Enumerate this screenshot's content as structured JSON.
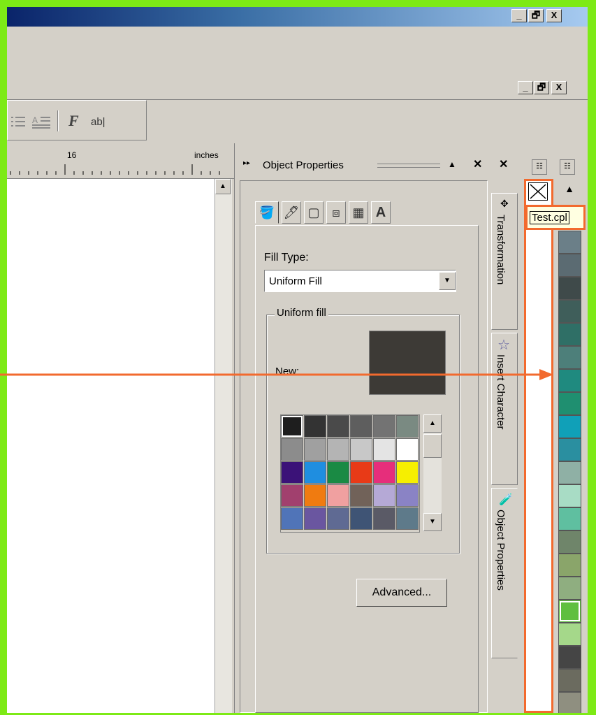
{
  "toolbar": {
    "format_f": "F",
    "text_ab": "ab|"
  },
  "ruler": {
    "tick_16": "16",
    "units": "inches"
  },
  "docker": {
    "title": "Object Properties",
    "fill_type_label": "Fill Type:",
    "fill_type_value": "Uniform Fill",
    "group_label": "Uniform fill",
    "new_label": "New:",
    "new_color": "#3d3a36",
    "advanced_button": "Advanced...",
    "tabs": [
      "fill-icon",
      "outline-icon",
      "general-icon",
      "detail-icon",
      "wrap-icon",
      "text-icon"
    ],
    "swatches": [
      "#1e1e1e",
      "#333333",
      "#4a4a4a",
      "#5e5e5e",
      "#737373",
      "#7a8a82",
      "#8c8c8c",
      "#a0a0a0",
      "#b4b4b4",
      "#c8c8c8",
      "#e4e4e4",
      "#ffffff",
      "#3b1278",
      "#1f8ee0",
      "#1a8a44",
      "#e83a17",
      "#e62e7b",
      "#f6ef00",
      "#a1406e",
      "#f07b10",
      "#f0a0a0",
      "#716259",
      "#b5a9d6",
      "#8a83c5",
      "#5074b8",
      "#6a56a0",
      "#5f6a93",
      "#3f5475",
      "#5a5a66",
      "#5e7a8a"
    ]
  },
  "side_tabs": [
    "Transformation",
    "Insert Character",
    "Object Properties"
  ],
  "palette": {
    "tooltip": "Test.cpl",
    "colors": [
      "#6b7f88",
      "#5b6b72",
      "#3f4a4a",
      "#3f5e5a",
      "#2f6f66",
      "#4d7f7a",
      "#1f8a7f",
      "#1f8f70",
      "#10a0b8",
      "#2a8fa0",
      "#8fb0a5",
      "#a8dcc5",
      "#5fbfa0",
      "#6f856a",
      "#8aa56a",
      "#8fae80",
      "#5fbf3f",
      "#a5d88a",
      "#454545",
      "#6b6b5f",
      "#8f8f80"
    ]
  },
  "titlebar_buttons": [
    "_",
    "🗗",
    "X"
  ]
}
